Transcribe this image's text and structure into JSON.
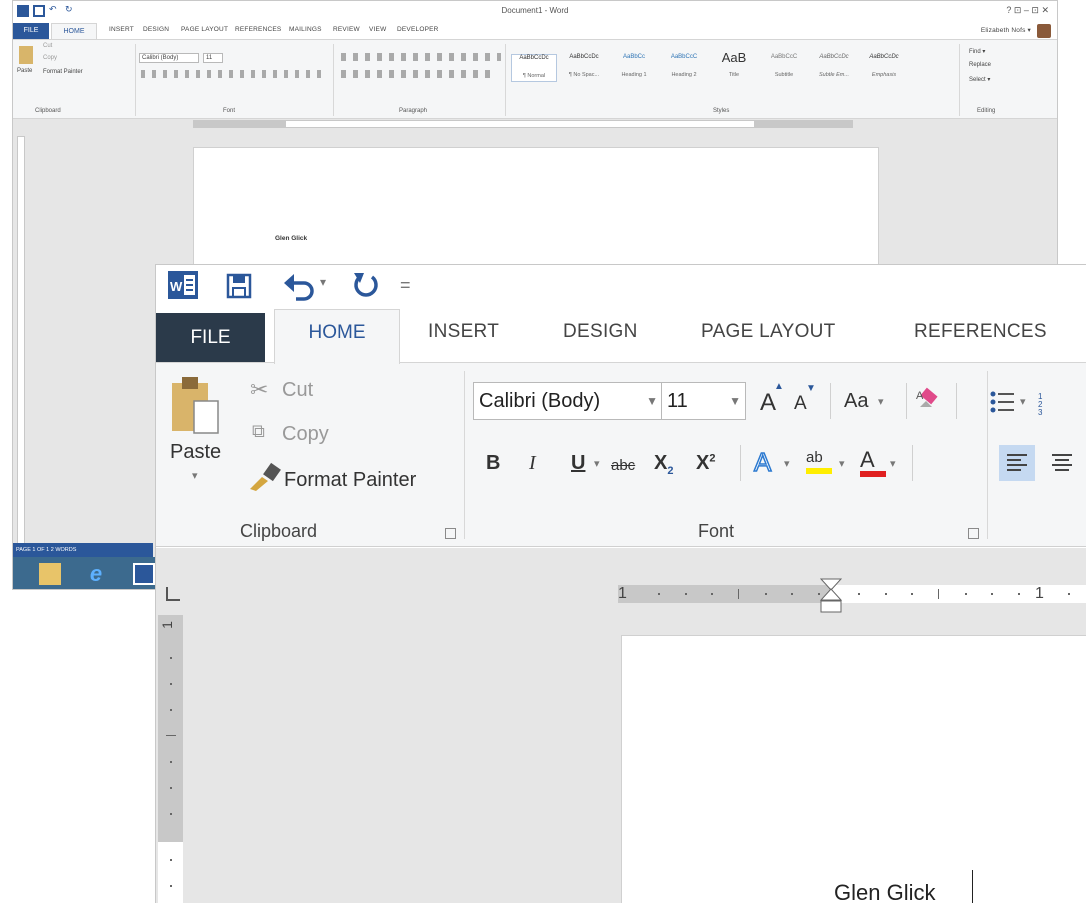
{
  "small_window": {
    "title": "Document1 - Word",
    "controls": "? ⊡ –  ⊡ ✕",
    "user": "Elizabeth Nofs ▾",
    "tabs": {
      "file": "FILE",
      "home": "HOME",
      "others": [
        "INSERT",
        "DESIGN",
        "PAGE LAYOUT",
        "REFERENCES",
        "MAILINGS",
        "REVIEW",
        "VIEW",
        "DEVELOPER"
      ]
    },
    "clipboard": {
      "cut": "Cut",
      "copy": "Copy",
      "paste": "Paste",
      "format_painter": "Format Painter",
      "group": "Clipboard"
    },
    "font": {
      "name": "Calibri (Body)",
      "size": "11",
      "group": "Font"
    },
    "paragraph_group": "Paragraph",
    "styles": {
      "group": "Styles",
      "items": [
        {
          "sample": "AaBbCcDc",
          "name": "¶ Normal"
        },
        {
          "sample": "AaBbCcDc",
          "name": "¶ No Spac..."
        },
        {
          "sample": "AaBbCc",
          "name": "Heading 1"
        },
        {
          "sample": "AaBbCcC",
          "name": "Heading 2"
        },
        {
          "sample": "AaB",
          "name": "Title"
        },
        {
          "sample": "AaBbCcC",
          "name": "Subtitle"
        },
        {
          "sample": "AaBbCcDc",
          "name": "Subtle Em..."
        },
        {
          "sample": "AaBbCcDc",
          "name": "Emphasis"
        }
      ]
    },
    "editing": {
      "find": "Find ▾",
      "replace": "Replace",
      "select": "Select ▾",
      "group": "Editing"
    },
    "document_text": "Glen Glick",
    "status": "PAGE 1 OF 1    2 WORDS"
  },
  "big_window": {
    "qat_more": "=",
    "tabs": {
      "file": "FILE",
      "home": "HOME",
      "insert": "INSERT",
      "design": "DESIGN",
      "page_layout": "PAGE LAYOUT",
      "references": "REFERENCES"
    },
    "clipboard": {
      "paste": "Paste",
      "paste_arrow": "▾",
      "cut": "Cut",
      "copy": "Copy",
      "format_painter": "Format Painter",
      "group": "Clipboard"
    },
    "font": {
      "name": "Calibri (Body)",
      "size": "11",
      "grow": "A",
      "shrink": "A",
      "change_case": "Aa",
      "bold": "B",
      "italic": "I",
      "underline": "U",
      "strike": "abc",
      "subscript": "X",
      "superscript": "X",
      "text_effects": "A",
      "highlight": "ab",
      "font_color": "A",
      "group": "Font"
    },
    "ruler": {
      "left_number": "1",
      "right_number": "1",
      "v_number": "1"
    },
    "document_text": "Glen Glick",
    "colors": {
      "accent": "#2b579a",
      "file_tab": "#2b3a4a",
      "highlight": "#ffee00",
      "font_color": "#e02020"
    }
  }
}
